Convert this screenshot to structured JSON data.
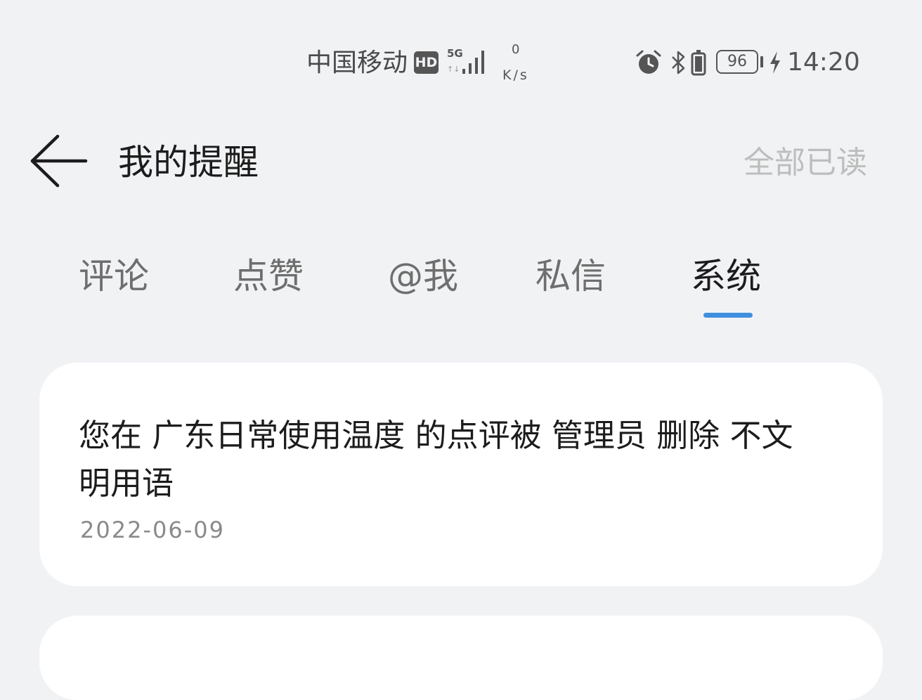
{
  "status_bar": {
    "carrier": "中国移动",
    "hd": "HD",
    "network_type": "5G",
    "network_arrows": "↑↓",
    "net_speed_value": "0",
    "net_speed_unit": "K/s",
    "battery_level": "96",
    "time": "14:20",
    "icons": [
      "alarm-icon",
      "bluetooth-icon",
      "vibrate-icon",
      "battery-icon",
      "charging-icon"
    ]
  },
  "header": {
    "back_icon": "arrow-left-icon",
    "title": "我的提醒",
    "mark_all_read": "全部已读"
  },
  "tabs": [
    {
      "label": "评论",
      "active": false
    },
    {
      "label": "点赞",
      "active": false
    },
    {
      "label": "@我",
      "active": false
    },
    {
      "label": "私信",
      "active": false
    },
    {
      "label": "系统",
      "active": true
    }
  ],
  "colors": {
    "background": "#f1f2f4",
    "card": "#ffffff",
    "accent": "#3f8fe0",
    "muted_text": "#8a8a8a",
    "disabled_text": "#bdbdbd"
  },
  "notifications": [
    {
      "message": "您在 广东日常使用温度 的点评被 管理员 删除 不文明用语",
      "date": "2022-06-09"
    }
  ]
}
